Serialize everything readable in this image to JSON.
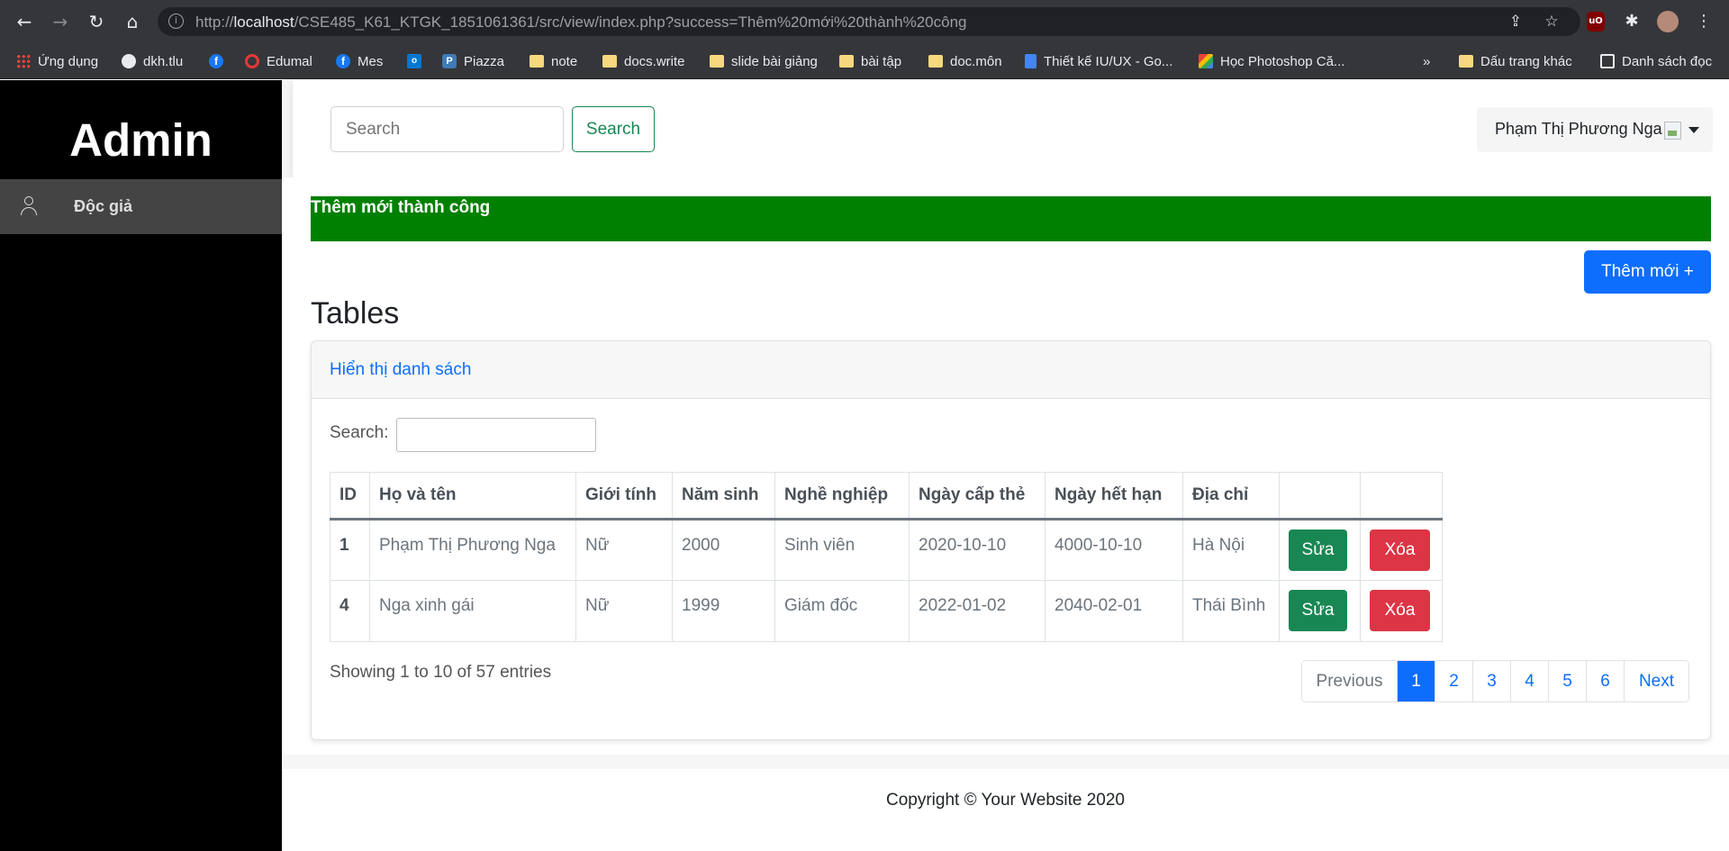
{
  "browser": {
    "url_prefix": "http://",
    "url_host": "localhost",
    "url_path": "/CSE485_K61_KTGK_1851061361/src/view/index.php?success=Thêm%20mới%20thành%20công",
    "bookmarks": [
      {
        "label": "Ứng dụng",
        "icon": "apps-grid-icon"
      },
      {
        "label": "dkh.tlu",
        "icon": "globe-icon"
      },
      {
        "label": "",
        "icon": "facebook-icon"
      },
      {
        "label": "Edumal",
        "icon": "edumal-icon"
      },
      {
        "label": "Mes",
        "icon": "facebook-icon"
      },
      {
        "label": "",
        "icon": "outlook-icon"
      },
      {
        "label": "Piazza",
        "icon": "piazza-icon"
      },
      {
        "label": "note",
        "icon": "folder-icon"
      },
      {
        "label": "docs.write",
        "icon": "folder-icon"
      },
      {
        "label": "slide bài giảng",
        "icon": "folder-icon"
      },
      {
        "label": "bài tập",
        "icon": "folder-icon"
      },
      {
        "label": "doc.môn",
        "icon": "folder-icon"
      },
      {
        "label": "Thiết kế IU/UX - Go...",
        "icon": "google-docs-icon"
      },
      {
        "label": "Học Photoshop Că...",
        "icon": "photoshop-site-icon"
      }
    ],
    "bookmarks_overflow": "»",
    "other_bookmarks": "Dấu trang khác",
    "reading_list": "Danh sách đọc"
  },
  "sidebar": {
    "brand": "Admin",
    "items": [
      {
        "label": "Độc giả",
        "icon": "user-icon"
      }
    ]
  },
  "topbar": {
    "search_placeholder": "Search",
    "search_button": "Search",
    "user_name": "Phạm Thị Phương Nga"
  },
  "alert": {
    "text": "Thêm mới thành công",
    "color": "#008000"
  },
  "add_button": "Thêm mới +",
  "page_heading": "Tables",
  "card": {
    "title": "Hiển thị danh sách",
    "filter_label": "Search:",
    "filter_value": ""
  },
  "table": {
    "headers": [
      "ID",
      "Họ và tên",
      "Giới tính",
      "Năm sinh",
      "Nghề nghiệp",
      "Ngày cấp thẻ",
      "Ngày hết hạn",
      "Địa chỉ",
      "",
      ""
    ],
    "rows": [
      [
        "1",
        "Phạm Thị Phương Nga",
        "Nữ",
        "2000",
        "Sinh viên",
        "2020-10-10",
        "4000-10-10",
        "Hà Nội"
      ],
      [
        "4",
        "Nga xinh gái",
        "Nữ",
        "1999",
        "Giám đốc",
        "2022-01-02",
        "2040-02-01",
        "Thái Bình"
      ]
    ],
    "edit_label": "Sửa",
    "delete_label": "Xóa"
  },
  "pagination": {
    "info": "Showing 1 to 10 of 57 entries",
    "previous": "Previous",
    "pages": [
      "1",
      "2",
      "3",
      "4",
      "5",
      "6"
    ],
    "active_page": "1",
    "next": "Next"
  },
  "footer": {
    "copyright": "Copyright © Your Website 2020"
  },
  "colors": {
    "primary": "#0d6efd",
    "success": "#198754",
    "danger": "#dc3545",
    "sidebar_bg": "#000000",
    "sidebar_active": "#444444"
  }
}
